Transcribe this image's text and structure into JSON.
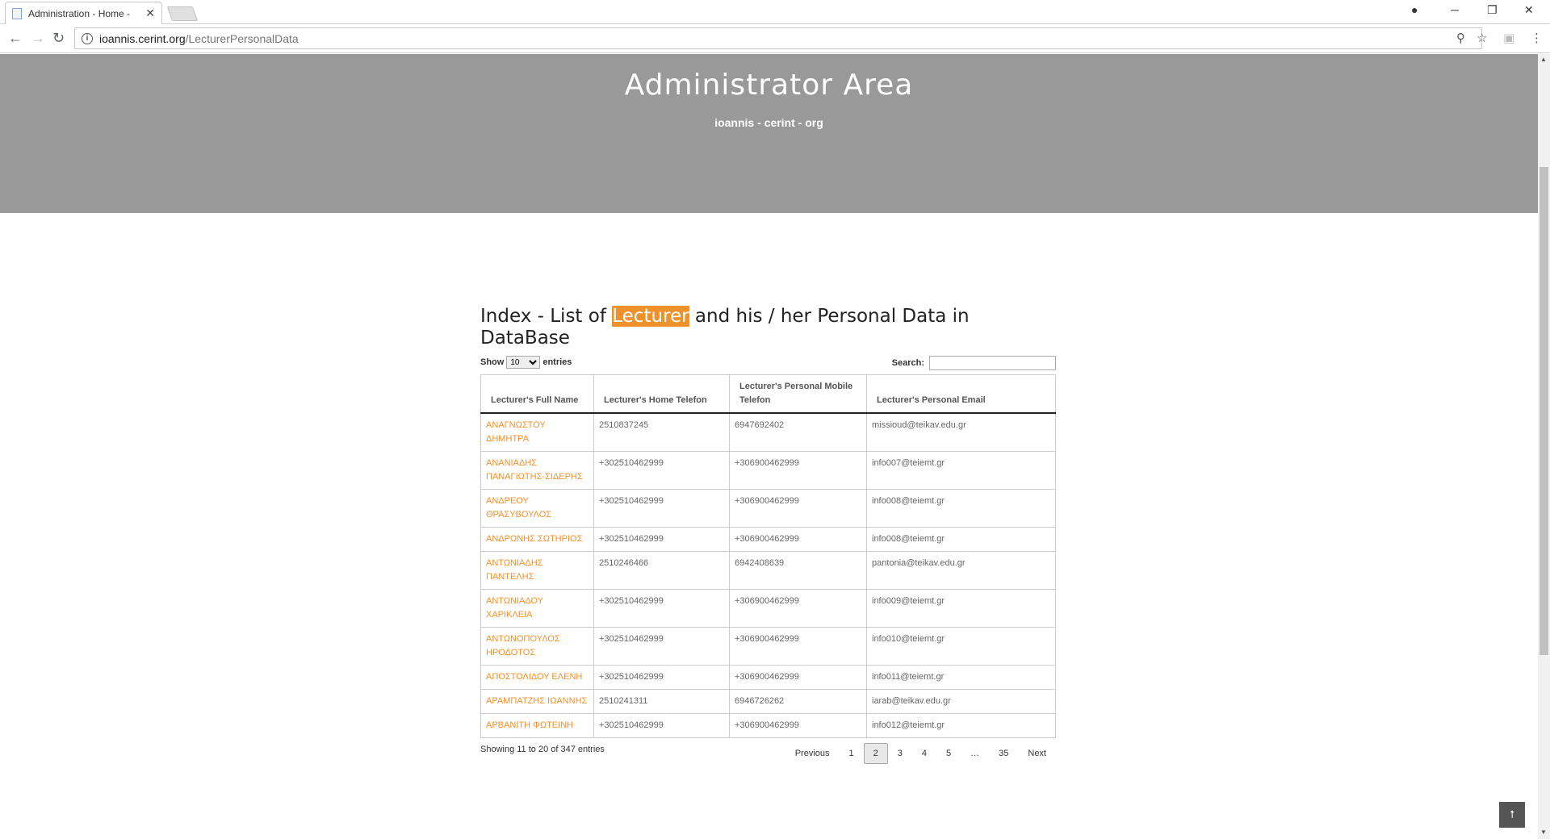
{
  "browser": {
    "tab_title": "Administration - Home -",
    "url_host": "ioannis.cerint.org",
    "url_path": "/LecturerPersonalData"
  },
  "hero": {
    "title": "Administrator Area",
    "subtitle": "ioannis - cerint - org"
  },
  "page": {
    "heading_before": "Index - List of ",
    "heading_highlight": "Lecturer",
    "heading_after": " and his / her Personal Data in DataBase",
    "show_label": "Show",
    "entries_label": "entries",
    "page_size": "10",
    "search_label": "Search:",
    "search_value": ""
  },
  "table": {
    "headers": [
      "Lecturer's Full Name",
      "Lecturer's Home Telefon",
      "Lecturer's Personal Mobile Telefon",
      "Lecturer's Personal Email"
    ],
    "rows": [
      [
        "ΑΝΑΓΝΩΣΤΟΥ ΔΗΜΗΤΡΑ",
        "2510837245",
        "6947692402",
        "missioud@teikav.edu.gr"
      ],
      [
        "ΑΝΑΝΙΑΔΗΣ ΠΑΝΑΓΙΩΤΗΣ-ΣΙΔΕΡΗΣ",
        "+302510462999",
        "+306900462999",
        "info007@teiemt.gr"
      ],
      [
        "ΑΝΔΡΕΟΥ ΘΡΑΣΥΒΟΥΛΟΣ",
        "+302510462999",
        "+306900462999",
        "info008@teiemt.gr"
      ],
      [
        "ΑΝΔΡΩΝΗΣ ΣΩΤΗΡΙΟΣ",
        "+302510462999",
        "+306900462999",
        "info008@teiemt.gr"
      ],
      [
        "ΑΝΤΩΝΙΑΔΗΣ ΠΑΝΤΕΛΗΣ",
        "2510246466",
        "6942408639",
        "pantonia@teikav.edu.gr"
      ],
      [
        "ΑΝΤΩΝΙΑΔΟΥ ΧΑΡΙΚΛΕΙΑ",
        "+302510462999",
        "+306900462999",
        "info009@teiemt.gr"
      ],
      [
        "ΑΝΤΩΝΟΠΟΥΛΟΣ ΗΡΟΔΟΤΟΣ",
        "+302510462999",
        "+306900462999",
        "info010@teiemt.gr"
      ],
      [
        "ΑΠΟΣΤΟΛΙΔΟΥ ΕΛΕΝΗ",
        "+302510462999",
        "+306900462999",
        "info011@teiemt.gr"
      ],
      [
        "ΑΡΑΜΠΑΤΖΗΣ ΙΩΑΝΝΗΣ",
        "2510241311",
        "6946726262",
        "iarab@teikav.edu.gr"
      ],
      [
        "ΑΡΒΑΝΙΤΗ ΦΩΤΕΙΝΗ",
        "+302510462999",
        "+306900462999",
        "info012@teiemt.gr"
      ]
    ]
  },
  "footer": {
    "info": "Showing 11 to 20 of 347 entries",
    "pages": [
      "Previous",
      "1",
      "2",
      "3",
      "4",
      "5",
      "…",
      "35",
      "Next"
    ],
    "current_page": "2"
  },
  "icons": {
    "back": "arrow-left-icon",
    "forward": "arrow-right-icon",
    "reload": "reload-icon",
    "zoom": "zoom-icon",
    "bookmark": "star-icon",
    "to_top": "arrow-up-icon"
  },
  "colors": {
    "accent": "#f0922b",
    "hero_bg": "#999999"
  }
}
